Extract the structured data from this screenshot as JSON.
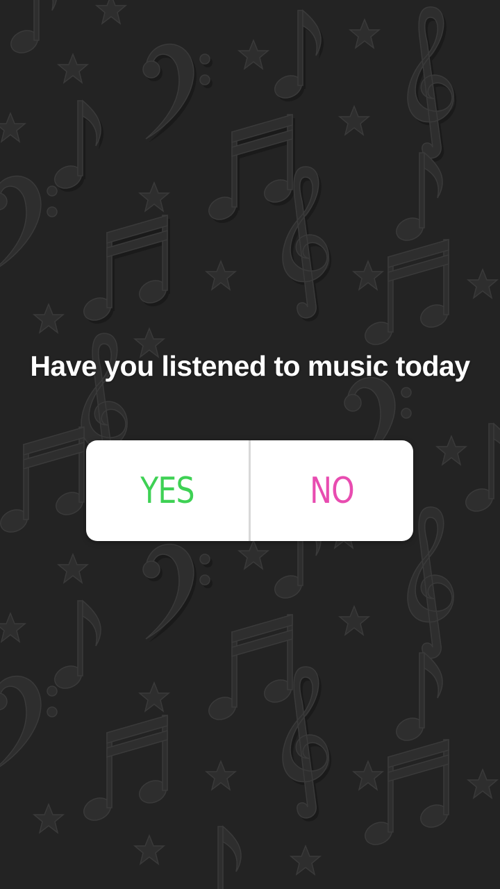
{
  "story": {
    "question": "Have you listened to music today",
    "background_pattern": "music-notes-and-stars",
    "background_color": "#232323"
  },
  "poll": {
    "yes_label": "YES",
    "no_label": "NO",
    "yes_color": "#3ed154",
    "no_color": "#e84cb0"
  }
}
